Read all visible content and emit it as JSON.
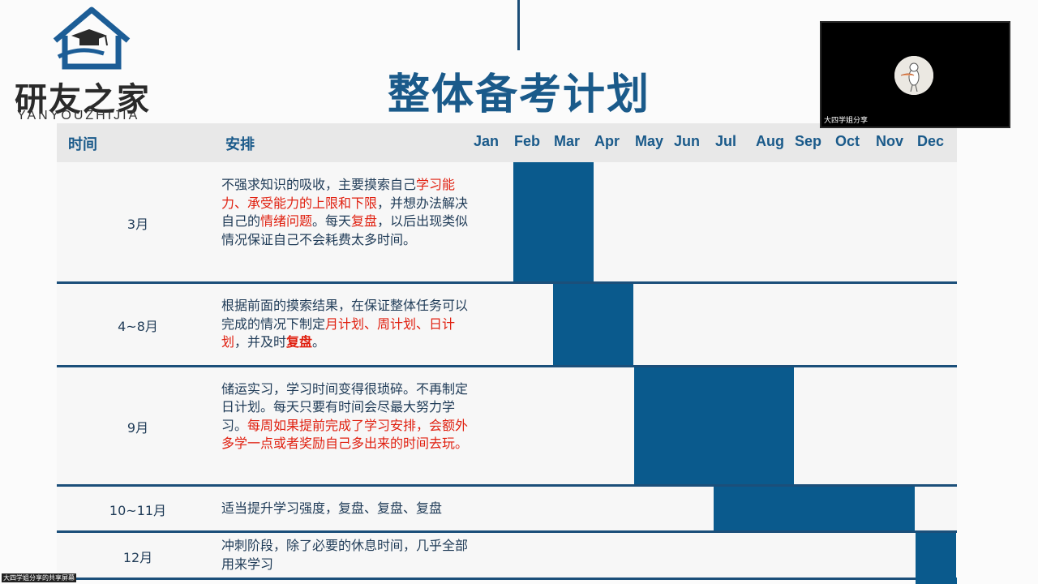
{
  "logo": {
    "cn": "研友之家",
    "en": "YANYOUZHIJIA",
    "colors": {
      "house": "#1c5d96",
      "cap": "#2a2a2a"
    }
  },
  "title": "整体备考计划",
  "video": {
    "participant_name": "大四学姐分享"
  },
  "bottom_label": "大四学姐分享的共享屏幕",
  "table": {
    "headers": {
      "time": "时间",
      "plan": "安排"
    },
    "months": [
      "Jan",
      "Feb",
      "Mar",
      "Apr",
      "May",
      "Jun",
      "Jul",
      "Aug",
      "Sep",
      "Oct",
      "Nov",
      "Dec"
    ],
    "rows": [
      {
        "time": "3月",
        "plan": [
          {
            "text": "不强求知识的吸收，主要摸索自己",
            "style": ""
          },
          {
            "text": "学习能力、承受能力的上限和下限",
            "style": "red"
          },
          {
            "text": "，并想办法解决自己的",
            "style": ""
          },
          {
            "text": "情绪问题",
            "style": "red"
          },
          {
            "text": "。每天",
            "style": ""
          },
          {
            "text": "复盘",
            "style": "red"
          },
          {
            "text": "，以后出现类似情况保证自己不会耗费太多时间。",
            "style": ""
          }
        ],
        "gantt_months": [
          1,
          2
        ]
      },
      {
        "time": "4~8月",
        "plan": [
          {
            "text": "根据前面的摸索结果，在保证整体任务可以完成的情况下制定",
            "style": ""
          },
          {
            "text": "月计划、周计划、日计划",
            "style": "red"
          },
          {
            "text": "，并及时",
            "style": ""
          },
          {
            "text": "复盘",
            "style": "red bold"
          },
          {
            "text": "。",
            "style": ""
          }
        ],
        "gantt_months": [
          2,
          3
        ]
      },
      {
        "time": "9月",
        "plan": [
          {
            "text": "储运实习，学习时间变得很琐碎。不再制定日计划。每天只要有时间会尽最大努力学习。",
            "style": ""
          },
          {
            "text": "每周如果提前完成了学习安排，会额外多学一点或者奖励自己多出来的时间去玩。",
            "style": "red"
          }
        ],
        "gantt_months": [
          4,
          5,
          6,
          7
        ]
      },
      {
        "time": "10~11月",
        "plan": [
          {
            "text": "适当提升学习强度，复盘、复盘、复盘",
            "style": ""
          }
        ],
        "gantt_months": [
          6,
          7,
          8,
          9,
          10
        ]
      },
      {
        "time": "12月",
        "plan": [
          {
            "text": "冲刺阶段，除了必要的休息时间，几乎全部用来学习",
            "style": ""
          }
        ],
        "gantt_months": [
          11
        ]
      }
    ]
  },
  "colors": {
    "accent": "#0a5a8d",
    "title": "#1a5a8a",
    "highlight": "#e02010"
  }
}
